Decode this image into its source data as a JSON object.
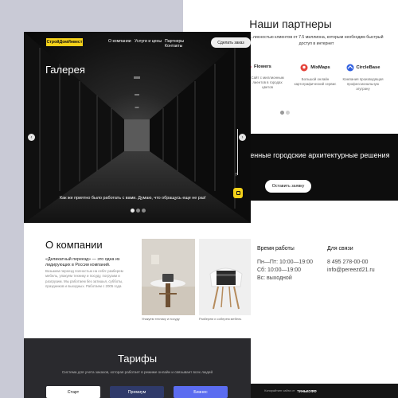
{
  "partners": {
    "title": "Наши партнеры",
    "subtitle": "...лисностью клиентов от 7.5 миллиона, которым необходим быстрый доступ в интернет",
    "items": [
      {
        "name": "Flowers",
        "desc": "Сайт с миллионным лиентов в городах\nцветов"
      },
      {
        "name": "MixMaps",
        "desc": "Большой онлайн картографический сервис"
      },
      {
        "name": "CircleBase",
        "desc": "Компания производящая профессиональную\nагуграну"
      }
    ]
  },
  "banner": {
    "text": "...ременные городские архитектурные решения",
    "button": "Оставить заявку"
  },
  "hours": {
    "title": "Время работы",
    "line1": "Пн—Пт: 10:00—19:00",
    "line2": "Сб: 10:00—19:00",
    "line3": "Вс: выходной"
  },
  "contacts": {
    "title": "Для связи",
    "phone": "8 495 278-00-00",
    "email": "info@pereezd21.ru"
  },
  "footer": {
    "text": "Копирайтинг сайта от",
    "brand": "ТИНЬКОФФ"
  },
  "nav": {
    "logo": "СтройДомИнвест",
    "links": [
      "О компании",
      "Услуги и цены",
      "Партнеры",
      "Контакты"
    ],
    "button": "Сделать заказ"
  },
  "hero": {
    "title": "Галерея",
    "caption": "Как же приятно было работать с вами. Думаю, что обращусь еще не раз!",
    "arrow_left": "‹",
    "arrow_right": "›",
    "up_arrow": "↑",
    "slide_index": 1,
    "slide_count": 3
  },
  "about": {
    "title": "О компании",
    "lead": "«Деликатный переезд» — это одна из лидирующих в России компаний.",
    "text": "Возьмем переезд полностью на себя: разберем мебель, упакуем технику и посуду, погрузим и разгрузим. Мы работаем без затишья, субботы, праздников и выходных. Работаем с 2005 года",
    "photos": [
      {
        "caption": "Упакуем технику и посуду"
      },
      {
        "caption": "Разберем и соберем мебель"
      }
    ]
  },
  "tariffs": {
    "title": "Тарифы",
    "subtitle": "Система для учета заказов, которая работает в режиме онлайн и связывает всех людей",
    "buttons": [
      "Старт",
      "Премиум",
      "Бизнес"
    ]
  },
  "colors": {
    "accent": "#f5d21a",
    "dark": "#2a2a2e",
    "blue": "#5b6cf0",
    "navy": "#2f3a6a"
  }
}
